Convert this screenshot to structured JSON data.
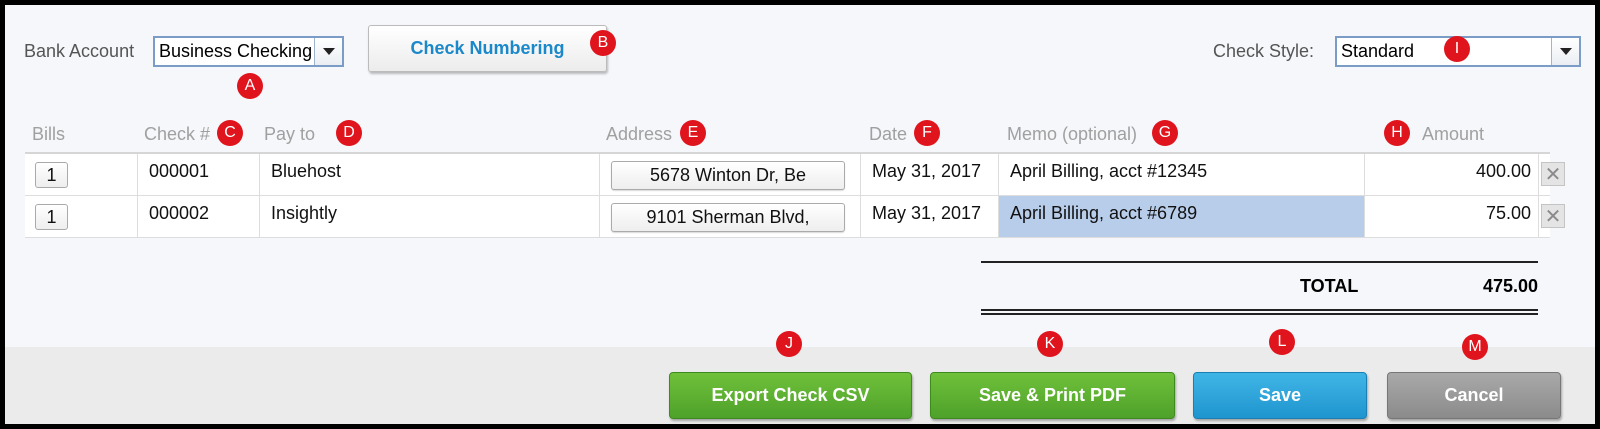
{
  "toolbar": {
    "bank_account_label": "Bank Account",
    "bank_account_value": "Business Checking",
    "check_numbering_label": "Check Numbering",
    "check_style_label": "Check Style:",
    "check_style_value": "Standard"
  },
  "table": {
    "headers": {
      "bills": "Bills",
      "check": "Check #",
      "pay_to": "Pay to",
      "address": "Address",
      "date": "Date",
      "memo": "Memo (optional)",
      "amount": "Amount"
    },
    "rows": [
      {
        "bills": "1",
        "check": "000001",
        "pay_to": "Bluehost",
        "address": "5678 Winton Dr, Be",
        "date": "May 31, 2017",
        "memo": "April Billing, acct #12345",
        "amount": "400.00"
      },
      {
        "bills": "1",
        "check": "000002",
        "pay_to": "Insightly",
        "address": "9101 Sherman Blvd,",
        "date": "May 31, 2017",
        "memo": "April Billing, acct #6789",
        "amount": "75.00"
      }
    ],
    "delete_icon": "close-icon"
  },
  "totals": {
    "label": "TOTAL",
    "value": "475.00"
  },
  "actions": {
    "export_csv": "Export Check CSV",
    "save_print": "Save & Print PDF",
    "save": "Save",
    "cancel": "Cancel"
  },
  "markers": {
    "a": "A",
    "b": "B",
    "c": "C",
    "d": "D",
    "e": "E",
    "f": "F",
    "g": "G",
    "h": "H",
    "i": "I",
    "j": "J",
    "k": "K",
    "l": "L",
    "m": "M"
  },
  "colors": {
    "accent_blue": "#1a88c9",
    "green_button": "#5bb032",
    "blue_button": "#2aa3dc",
    "gray_button": "#999999",
    "marker_red": "#e0141c",
    "memo_highlight": "#b8cdea"
  }
}
